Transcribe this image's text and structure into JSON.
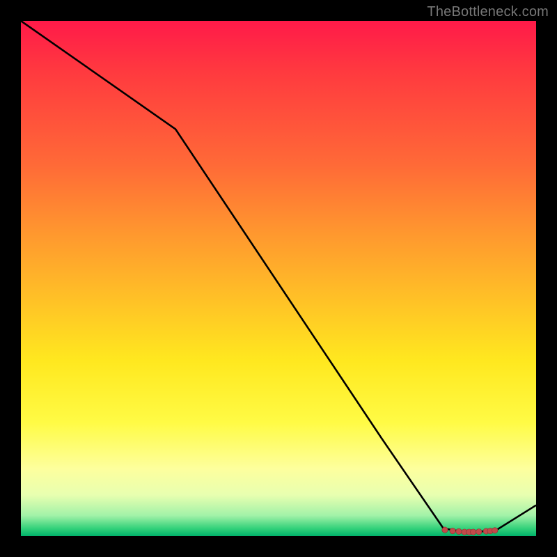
{
  "attribution": "TheBottleneck.com",
  "chart_data": {
    "type": "line",
    "title": "",
    "xlabel": "",
    "ylabel": "",
    "x": [
      0,
      0.3,
      0.4,
      0.5,
      0.6,
      0.7,
      0.82,
      0.86,
      0.92,
      1.0
    ],
    "values": [
      100,
      79,
      64,
      49,
      34,
      19,
      1.5,
      0.8,
      1.0,
      6
    ],
    "ylim": [
      0,
      100
    ],
    "xlim": [
      0,
      1
    ],
    "markers": {
      "x": [
        0.823,
        0.838,
        0.85,
        0.861,
        0.87,
        0.878,
        0.889,
        0.903,
        0.911,
        0.92
      ],
      "y": [
        1.2,
        1.0,
        0.9,
        0.8,
        0.8,
        0.8,
        0.85,
        0.95,
        1.0,
        1.1
      ]
    },
    "gradient_stops": [
      {
        "pos": 0.0,
        "color": "#ff1a49"
      },
      {
        "pos": 0.55,
        "color": "#ffc426"
      },
      {
        "pos": 0.87,
        "color": "#fdff9e"
      },
      {
        "pos": 1.0,
        "color": "#00b36b"
      }
    ]
  }
}
